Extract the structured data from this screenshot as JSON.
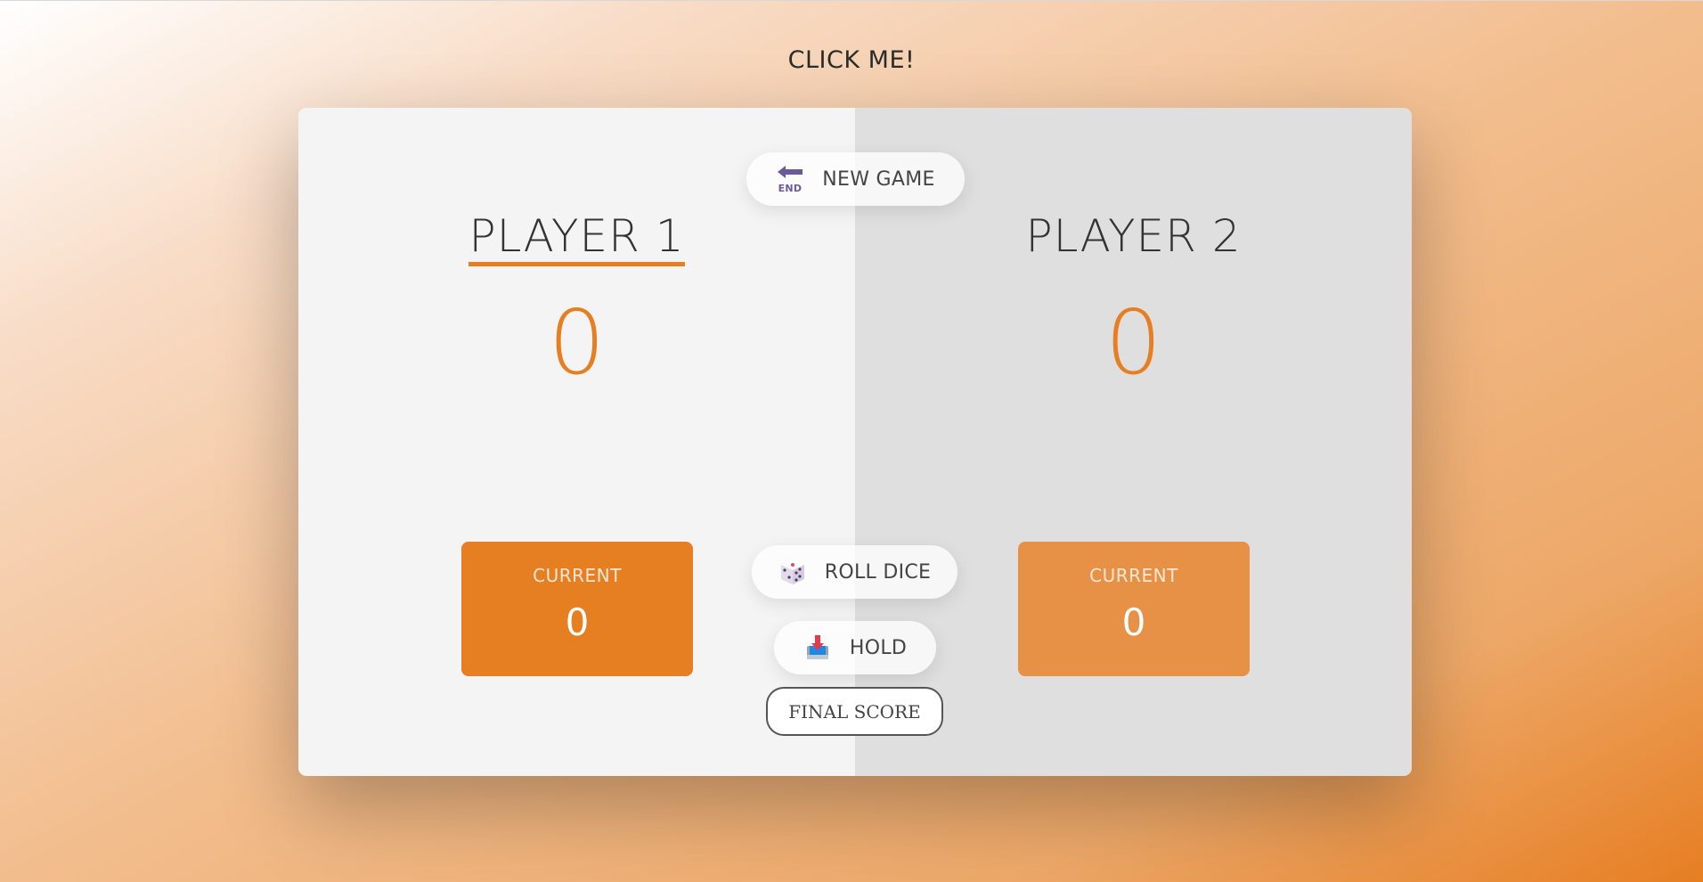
{
  "header": {
    "click_me_label": "CLICK ME!"
  },
  "players": [
    {
      "name": "PLAYER 1",
      "score": "0",
      "current_label": "CURRENT",
      "current_score": "0",
      "active": true
    },
    {
      "name": "PLAYER 2",
      "score": "0",
      "current_label": "CURRENT",
      "current_score": "0",
      "active": false
    }
  ],
  "controls": {
    "new_game": {
      "label": "NEW GAME",
      "icon": "end-arrow-icon"
    },
    "roll_dice": {
      "label": "ROLL DICE",
      "icon": "dice-icon"
    },
    "hold": {
      "label": "HOLD",
      "icon": "inbox-tray-icon"
    },
    "final_score": {
      "label": "FINAL SCORE"
    }
  },
  "colors": {
    "accent": "#e67e22",
    "active_panel": "#f4f4f4",
    "inactive_panel": "#dfdfdf",
    "current_active": "#e67e22",
    "current_inactive": "#e69146"
  }
}
